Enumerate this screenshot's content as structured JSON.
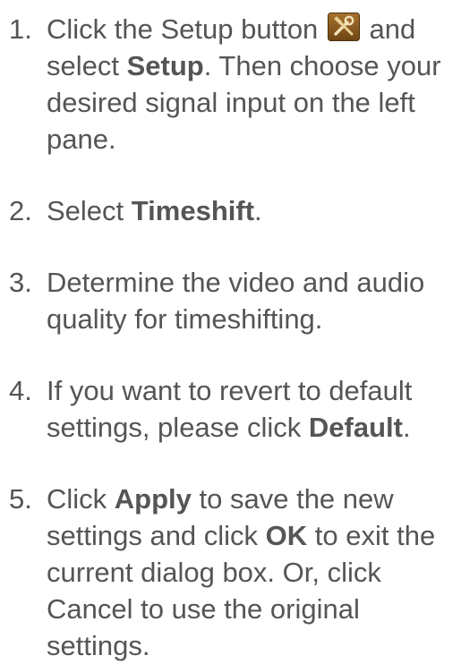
{
  "steps": [
    {
      "number": "1.",
      "text_before": "Click the Setup button ",
      "text_after_icon": " and select ",
      "bold": "Setup",
      "text_end": ". Then choose your desired signal input on the left pane.",
      "icon": "setup-tools-icon"
    },
    {
      "number": "2.",
      "text_before": "Select ",
      "bold": "Timeshift",
      "text_end": "."
    },
    {
      "number": "3.",
      "text": "Determine the video and audio quality for timeshifting."
    },
    {
      "number": "4.",
      "text_before": "If you want to revert to default settings, please click ",
      "bold": "Default",
      "text_end": "."
    },
    {
      "number": "5.",
      "text_before": "Click ",
      "bold": "Apply",
      "text_mid": " to save the new settings and click ",
      "bold2": "OK",
      "text_end": " to exit the current dialog box. Or, click Cancel to use the original settings."
    }
  ],
  "colors": {
    "text": "#555555",
    "icon_bg": "#8a5a1e",
    "icon_fg": "#f3e2b8"
  }
}
